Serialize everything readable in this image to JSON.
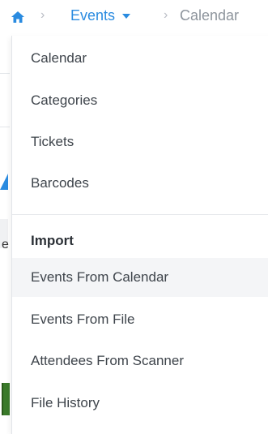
{
  "breadcrumb": {
    "home_icon": "home-icon",
    "events_label": "Events",
    "current_label": "Calendar",
    "separator": "›"
  },
  "menu": {
    "items": [
      {
        "label": "Calendar"
      },
      {
        "label": "Categories"
      },
      {
        "label": "Tickets"
      },
      {
        "label": "Barcodes"
      }
    ],
    "import_header": "Import",
    "import_items": [
      {
        "label": "Events From Calendar"
      },
      {
        "label": "Events From File"
      },
      {
        "label": "Attendees From Scanner"
      },
      {
        "label": "File History"
      }
    ]
  },
  "background_fragment": {
    "letter": "e"
  },
  "colors": {
    "accent": "#2a8be0",
    "muted": "#8d949c",
    "hover": "#f4f5f7"
  }
}
